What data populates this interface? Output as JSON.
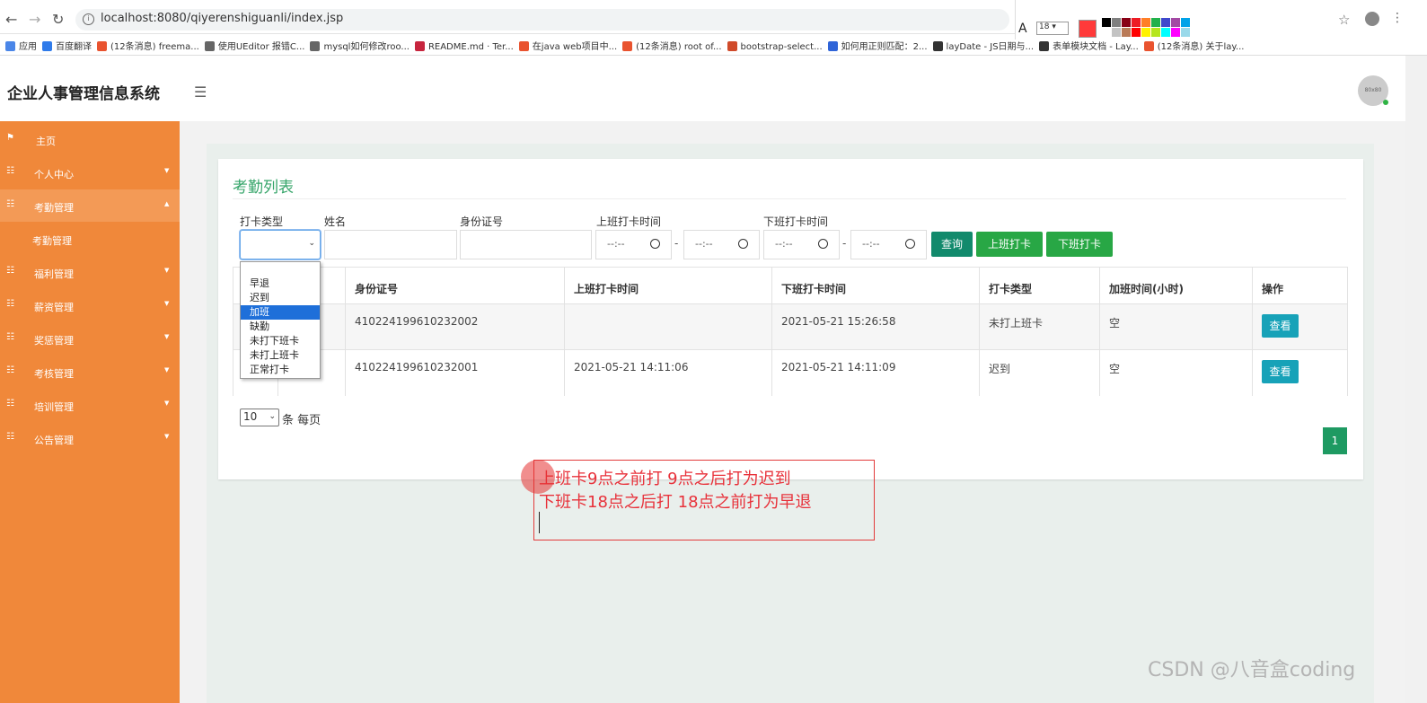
{
  "browser": {
    "url": "localhost:8080/qiyerenshiguanli/index.jsp",
    "bookmarks": [
      {
        "label": "应用",
        "color": "#4a86e8"
      },
      {
        "label": "百度翻译",
        "color": "#2f7bea"
      },
      {
        "label": "(12条消息) freema...",
        "color": "#e9532f"
      },
      {
        "label": "使用UEditor 报错C...",
        "color": "#666666"
      },
      {
        "label": "mysql如何修改roo...",
        "color": "#666666"
      },
      {
        "label": "README.md · Ter...",
        "color": "#c7253e"
      },
      {
        "label": "在java web项目中...",
        "color": "#e9532f"
      },
      {
        "label": "(12条消息) root of...",
        "color": "#e9532f"
      },
      {
        "label": "bootstrap-select...",
        "color": "#d04a2a"
      },
      {
        "label": "如何用正则匹配：2...",
        "color": "#2f64d8"
      },
      {
        "label": "layDate - JS日期与...",
        "color": "#333333"
      },
      {
        "label": "表单模块文档 - Lay...",
        "color": "#333333"
      },
      {
        "label": "(12条消息) 关于lay...",
        "color": "#e9532f"
      }
    ]
  },
  "annotation_toolbar": {
    "font_icon": "A",
    "font_size": "18",
    "active_color": "#ff3a3a",
    "palette": [
      "#000000",
      "#7f7f7f",
      "#880015",
      "#ed1c24",
      "#ff7f27",
      "#22b14c",
      "#3f48cc",
      "#a349a4",
      "#00a2e8",
      "#ffffff",
      "#c3c3c3",
      "#b97a57",
      "#ff0000",
      "#fff200",
      "#b5e61d",
      "#00ffff",
      "#ff00ff",
      "#99d9ea"
    ]
  },
  "header": {
    "title": "企业人事管理信息系统",
    "avatar_text": "80x80"
  },
  "sidebar": {
    "items": [
      {
        "label": "主页",
        "icon": "flag-icon",
        "has_caret": false,
        "active": false,
        "child": false
      },
      {
        "label": "个人中心",
        "icon": "grid-icon",
        "has_caret": true,
        "active": false,
        "child": false
      },
      {
        "label": "考勤管理",
        "icon": "grid-icon",
        "has_caret": true,
        "active": true,
        "child": false
      },
      {
        "label": "考勤管理",
        "icon": "",
        "has_caret": false,
        "active": false,
        "child": true
      },
      {
        "label": "福利管理",
        "icon": "grid-icon",
        "has_caret": true,
        "active": false,
        "child": false
      },
      {
        "label": "薪资管理",
        "icon": "grid-icon",
        "has_caret": true,
        "active": false,
        "child": false
      },
      {
        "label": "奖惩管理",
        "icon": "grid-icon",
        "has_caret": true,
        "active": false,
        "child": false
      },
      {
        "label": "考核管理",
        "icon": "grid-icon",
        "has_caret": true,
        "active": false,
        "child": false
      },
      {
        "label": "培训管理",
        "icon": "grid-icon",
        "has_caret": true,
        "active": false,
        "child": false
      },
      {
        "label": "公告管理",
        "icon": "grid-icon",
        "has_caret": true,
        "active": false,
        "child": false
      }
    ]
  },
  "main": {
    "card_title": "考勤列表",
    "filters": {
      "type_label": "打卡类型",
      "name_label": "姓名",
      "id_label": "身份证号",
      "in_time_label": "上班打卡时间",
      "out_time_label": "下班打卡时间",
      "time_placeholder": "--:--",
      "range_sep": "-"
    },
    "buttons": {
      "search": "查询",
      "clock_in": "上班打卡",
      "clock_out": "下班打卡"
    },
    "dropdown_options": [
      "早退",
      "迟到",
      "加班",
      "缺勤",
      "未打下班卡",
      "未打上班卡",
      "正常打卡"
    ],
    "dropdown_selected_index": 2,
    "table": {
      "headers": [
        "身份证号",
        "上班打卡时间",
        "下班打卡时间",
        "打卡类型",
        "加班时间(小时)",
        "操作"
      ],
      "rows": [
        {
          "id": "410224199610232002",
          "in": "",
          "out": "2021-05-21 15:26:58",
          "type": "未打上班卡",
          "overtime": "空",
          "action": "查看"
        },
        {
          "id": "410224199610232001",
          "in": "2021-05-21 14:11:06",
          "out": "2021-05-21 14:11:09",
          "type": "迟到",
          "overtime": "空",
          "action": "查看"
        }
      ]
    },
    "page_size": "10",
    "page_size_label": "条 每页",
    "current_page": "1"
  },
  "note": {
    "line1": "上班卡9点之前打 9点之后打为迟到",
    "line2": "下班卡18点之后打 18点之前打为早退",
    "color": "#e8313a"
  },
  "watermark": "CSDN @八音盒coding"
}
